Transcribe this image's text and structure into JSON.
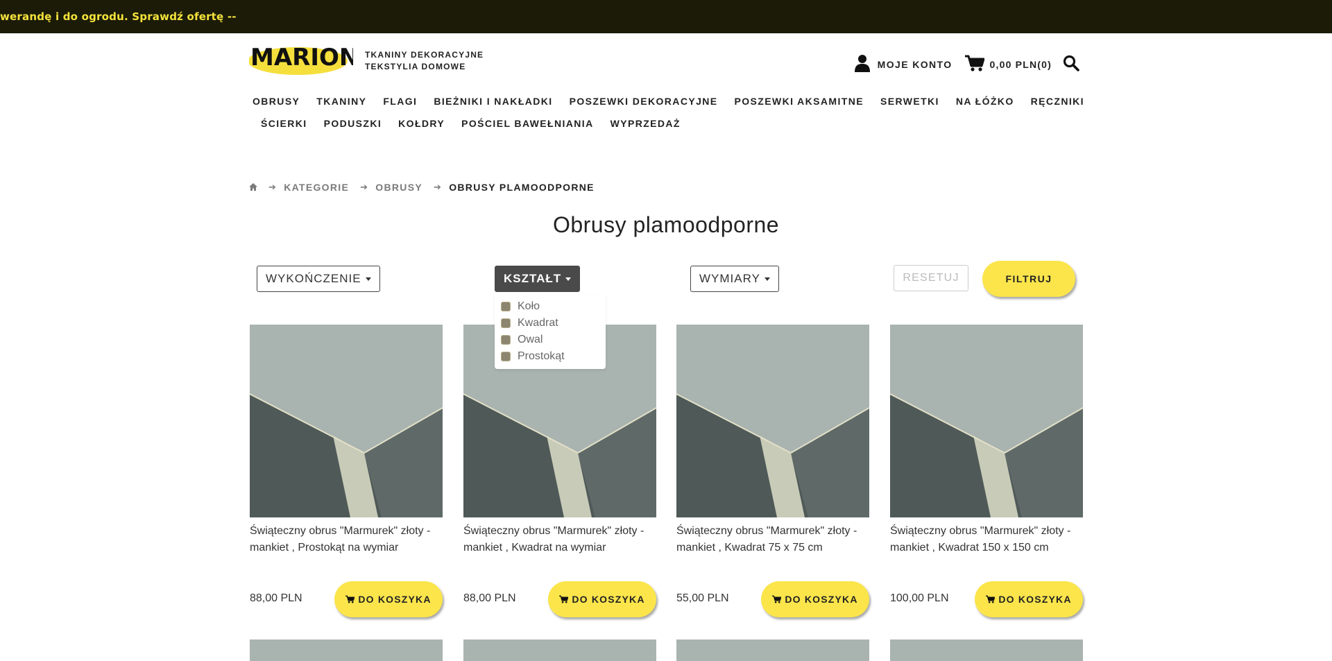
{
  "marquee": {
    "text": "werandę i do ogrodu. Sprawdź ofertę --"
  },
  "header": {
    "logo_text": "MARION",
    "tagline_line1": "TKANINY DEKORACYJNE",
    "tagline_line2": "TEKSTYLIA DOMOWE",
    "account_label": "MOJE KONTO",
    "cart_label": "0,00 PLN(0)"
  },
  "nav": {
    "row1": [
      "OBRUSY",
      "TKANINY",
      "FLAGI",
      "BIEŻNIKI I NAKŁADKI",
      "POSZEWKI DEKORACYJNE",
      "POSZEWKI AKSAMITNE",
      "SERWETKI",
      "NA ŁÓŻKO",
      "RĘCZNIKI"
    ],
    "row2": [
      "ŚCIERKI",
      "PODUSZKI",
      "KOŁDRY",
      "POŚCIEL BAWEŁNIANIA",
      "WYPRZEDAŻ"
    ]
  },
  "breadcrumb": {
    "items": [
      "KATEGORIE",
      "OBRUSY"
    ],
    "current": "OBRUSY PLAMOODPORNE"
  },
  "page": {
    "title": "Obrusy plamoodporne"
  },
  "filters": {
    "finish_label": "WYKOŃCZENIE",
    "shape_label": "KSZTAŁT",
    "size_label": "WYMIARY",
    "reset_label": "RESETUJ",
    "submit_label": "FILTRUJ",
    "shape_options": [
      "Koło",
      "Kwadrat",
      "Owal",
      "Prostokąt"
    ]
  },
  "products": [
    {
      "name": "Świąteczny obrus \"Marmurek\" złoty - mankiet , Prostokąt na wymiar",
      "price": "88,00 PLN",
      "button": "DO KOSZYKA"
    },
    {
      "name": "Świąteczny obrus \"Marmurek\" złoty - mankiet , Kwadrat na wymiar",
      "price": "88,00 PLN",
      "button": "DO KOSZYKA"
    },
    {
      "name": "Świąteczny obrus \"Marmurek\" złoty - mankiet , Kwadrat 75 x 75 cm",
      "price": "55,00 PLN",
      "button": "DO KOSZYKA"
    },
    {
      "name": "Świąteczny obrus \"Marmurek\" złoty - mankiet , Kwadrat 150 x 150 cm",
      "price": "100,00 PLN",
      "button": "DO KOSZYKA"
    }
  ],
  "colors": {
    "topbar_bg": "#1b1b07",
    "marquee_text": "#f5e33c",
    "accent_yellow": "#fbe54b",
    "active_filter": "#4a4a4a"
  },
  "icons": [
    "home-icon",
    "user-icon",
    "cart-icon",
    "search-icon",
    "arrow-right-icon",
    "caret-down-icon",
    "checkbox-icon"
  ]
}
